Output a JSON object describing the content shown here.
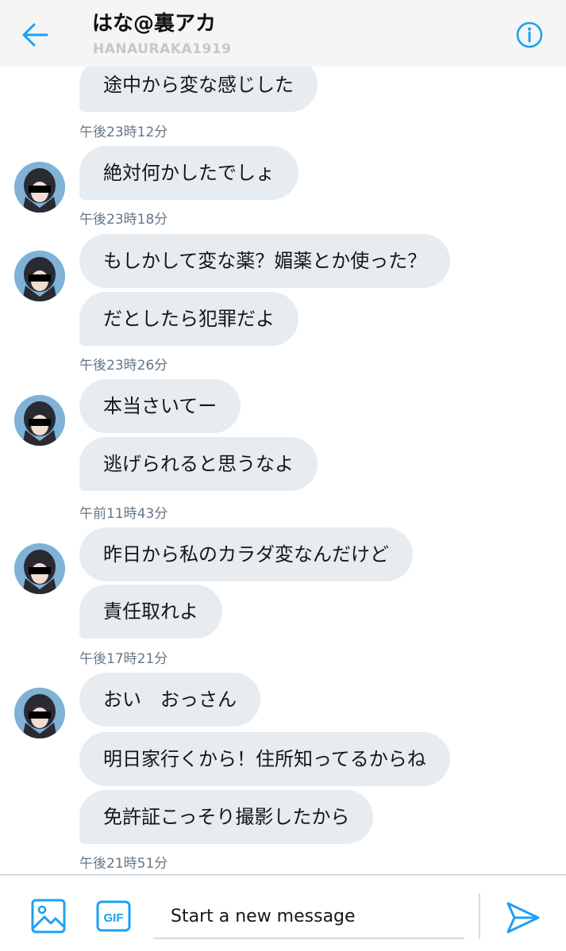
{
  "header": {
    "title": "はな@裏アカ",
    "handle": "HANAURAKA1919",
    "back_icon": "arrow-left-icon",
    "info_icon": "info-icon"
  },
  "colors": {
    "accent": "#1da1f2",
    "bubble": "#e6ecf0",
    "timestamp": "#657786",
    "header_bg": "#f5f5f5"
  },
  "messages": [
    {
      "text": "途中から変な感じした"
    },
    {
      "timestamp": "午後23時12分"
    },
    {
      "text": "絶対何かしたでしょ"
    },
    {
      "timestamp": "午後23時18分"
    },
    {
      "text": "もしかして変な薬？媚薬とか使った？"
    },
    {
      "text": "だとしたら犯罪だよ"
    },
    {
      "timestamp": "午後23時26分"
    },
    {
      "text": "本当さいてー"
    },
    {
      "text": "逃げられると思うなよ"
    },
    {
      "timestamp": "午前11時43分"
    },
    {
      "text": "昨日から私のカラダ変なんだけど"
    },
    {
      "text": "責任取れよ"
    },
    {
      "timestamp": "午後17時21分"
    },
    {
      "text": "おい　おっさん"
    },
    {
      "text": "明日家行くから！住所知ってるからね"
    },
    {
      "text": "免許証こっそり撮影したから"
    },
    {
      "timestamp": "午後21時51分"
    }
  ],
  "composer": {
    "placeholder": "Start a new message",
    "media_icon": "image-icon",
    "gif_label": "GIF",
    "send_icon": "send-icon"
  }
}
